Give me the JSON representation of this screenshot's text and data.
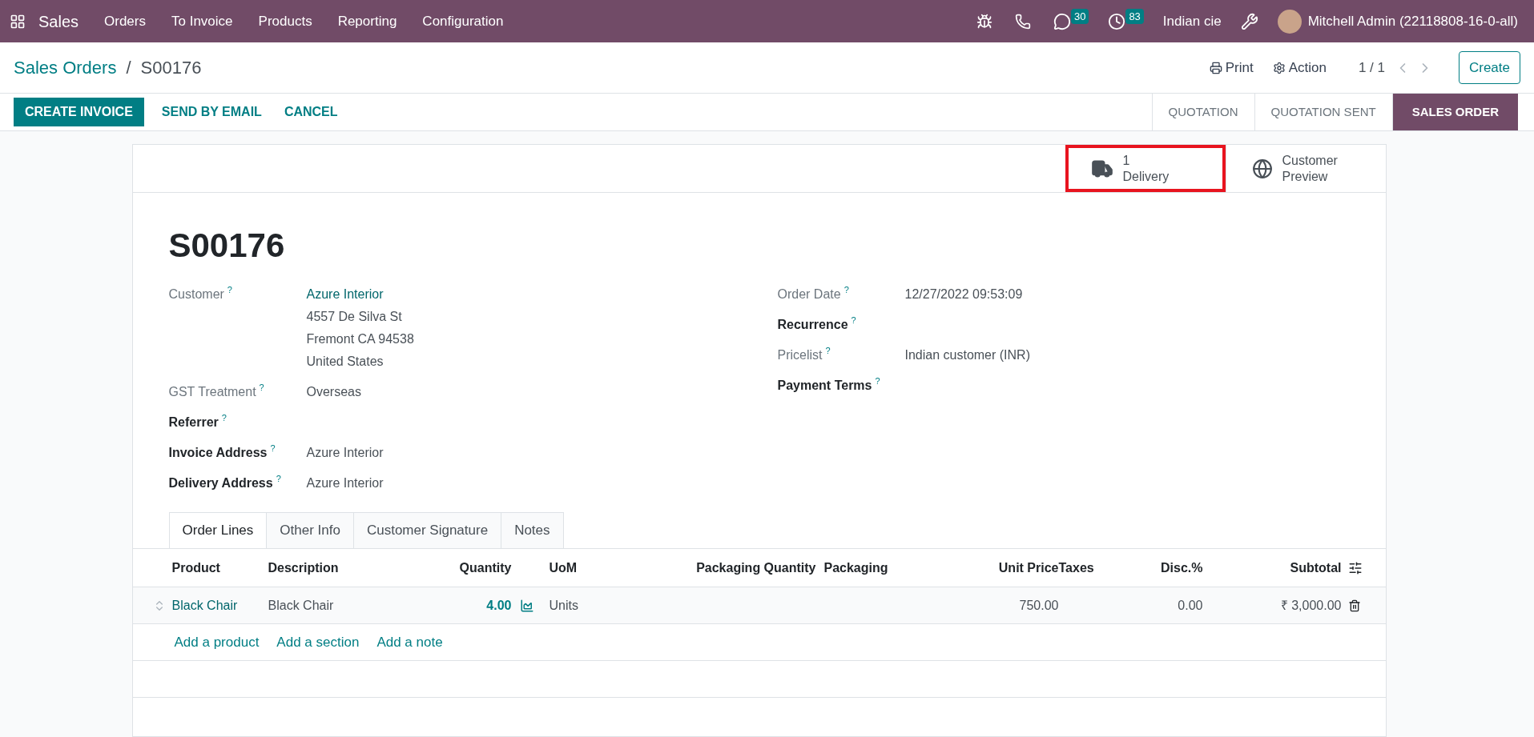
{
  "navbar": {
    "app": "Sales",
    "menu": [
      "Orders",
      "To Invoice",
      "Products",
      "Reporting",
      "Configuration"
    ],
    "messages_badge": "30",
    "activities_badge": "83",
    "company": "Indian cie",
    "user": "Mitchell Admin (22118808-16-0-all)"
  },
  "breadcrumb": {
    "parent": "Sales Orders",
    "separator": "/",
    "current": "S00176"
  },
  "control_panel": {
    "print": "Print",
    "action": "Action",
    "pager": "1 / 1",
    "create": "Create"
  },
  "actions": [
    {
      "label": "CREATE INVOICE",
      "primary": true
    },
    {
      "label": "SEND BY EMAIL",
      "primary": false
    },
    {
      "label": "CANCEL",
      "primary": false
    }
  ],
  "status_steps": [
    {
      "label": "QUOTATION",
      "selected": false
    },
    {
      "label": "QUOTATION SENT",
      "selected": false
    },
    {
      "label": "SALES ORDER",
      "selected": true
    }
  ],
  "smart_buttons": [
    {
      "kind": "delivery",
      "value": "1",
      "label": "Delivery",
      "highlighted": true
    },
    {
      "kind": "preview",
      "value": "Customer",
      "label": "Preview",
      "highlighted": false
    }
  ],
  "title": "S00176",
  "left_fields": [
    {
      "label": "Customer",
      "readonly": true,
      "link": "Azure Interior",
      "values": [
        "4557 De Silva St",
        "Fremont CA 94538",
        "United States"
      ]
    },
    {
      "label": "GST Treatment",
      "readonly": true,
      "values": [
        "Overseas"
      ]
    },
    {
      "label": "Referrer",
      "readonly": false
    },
    {
      "label": "Invoice Address",
      "readonly": false,
      "values": [
        "Azure Interior"
      ]
    },
    {
      "label": "Delivery Address",
      "readonly": false,
      "values": [
        "Azure Interior"
      ]
    }
  ],
  "right_fields": [
    {
      "label": "Order Date",
      "readonly": true,
      "values": [
        "12/27/2022 09:53:09"
      ]
    },
    {
      "label": "Recurrence",
      "readonly": false
    },
    {
      "label": "Pricelist",
      "readonly": true,
      "values": [
        "Indian customer (INR)"
      ]
    },
    {
      "label": "Payment Terms",
      "readonly": false
    }
  ],
  "help_mark": "?",
  "tabs": [
    {
      "label": "Order Lines",
      "selected": true
    },
    {
      "label": "Other Info",
      "selected": false
    },
    {
      "label": "Customer Signature",
      "selected": false
    },
    {
      "label": "Notes",
      "selected": false
    }
  ],
  "table": {
    "columns": [
      "Product",
      "Description",
      "Quantity",
      "UoM",
      "Packaging Quantity",
      "Packaging",
      "Unit Price",
      "Taxes",
      "Disc.%",
      "Subtotal"
    ],
    "rows": [
      {
        "product": "Black Chair",
        "description": "Black Chair",
        "quantity": "4.00",
        "uom": "Units",
        "unit_price": "750.00",
        "discount": "0.00",
        "subtotal": "₹ 3,000.00"
      }
    ],
    "add_links": [
      "Add a product",
      "Add a section",
      "Add a note"
    ]
  }
}
